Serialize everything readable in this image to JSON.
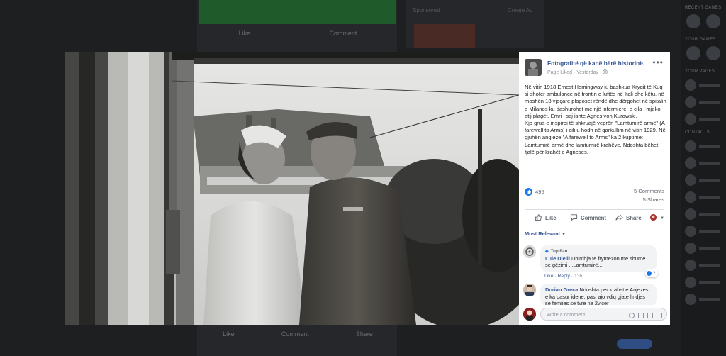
{
  "background": {
    "feed_like": "Like",
    "feed_comment": "Comment",
    "sponsored": "Sponsored",
    "create_ad": "Create Ad",
    "bottom_like": "Like",
    "bottom_comment": "Comment",
    "bottom_share": "Share",
    "right_header": "RECENT GAMES",
    "right_your_games": "YOUR GAMES",
    "right_your_pages": "YOUR PAGES",
    "right_contacts": "CONTACTS"
  },
  "post": {
    "page_name": "Fotografitë që kanë bërë historinë.",
    "page_liked": "Page Liked",
    "time": "Yesterday",
    "paragraph1": "Në vitin 1918 Ernest Hemingway iu bashkua Kryqit të Kuq si shofer ambulance në frontin e luftës në Itali dhe këtu, në moshën 18 vjeçare plagoset rëndë dhe dërgohet në spitalin e Milanos ku dashurohet me një infermiere, e cila i mjekoi atij plagët. Emri i saj ishte Agnes von Kurowski.",
    "paragraph2": "Kjo grua e inspiroi të shkruajë veprën \"Lamtumirë armë\" (A farewell to Arms) i cili u hodh në qarkullim në vitin 1929. Në gjuhën angleze \"A farewell to Arms\" ka 2 kuptime: Lamtumirë armë dhe lamtumirë krahëve. Ndoshta bëhet fjalë për krahët e Agneses.",
    "likes": "495",
    "comments": "5 Comments",
    "shares": "5 Shares"
  },
  "actions": {
    "like": "Like",
    "comment": "Comment",
    "share": "Share"
  },
  "sort_label": "Most Relevant",
  "comments": [
    {
      "badge": "Top Fan",
      "author": "Lule Dielli",
      "text": "Dhimbja të frymëzon më shumë se gëzimi ...Lamtumirë...",
      "like": "Like",
      "reply": "Reply",
      "time": "13h",
      "reactions": "2"
    },
    {
      "author": "Dorian Greca",
      "text": "Ndoshta per krahet e Anjezes e ka pasur idene, pasi ajo vdiq gjate lindjes se femijes se tyre ne 2vjcer"
    }
  ],
  "composer": {
    "placeholder": "Write a comment..."
  },
  "colors": {
    "link_blue": "#385898",
    "like_blue": "#1877f2",
    "overlay": "#1e1f21"
  }
}
